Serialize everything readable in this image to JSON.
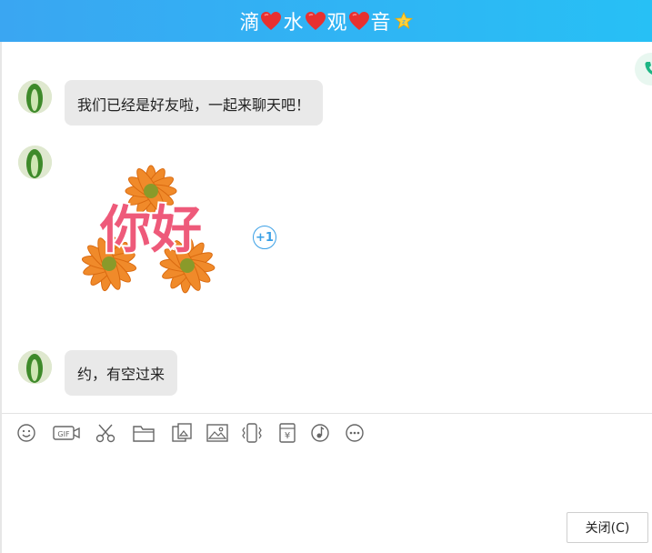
{
  "window": {
    "title_parts": [
      "滴",
      "水",
      "观",
      "音"
    ]
  },
  "messages": [
    {
      "type": "text",
      "text": "我们已经是好友啦，一起来聊天吧！"
    },
    {
      "type": "sticker",
      "sticker_text": "你好",
      "reaction": "+1"
    },
    {
      "type": "text",
      "text": "约，有空过来"
    }
  ],
  "toolbar": {
    "icons": [
      "emoji-icon",
      "gif-icon",
      "scissors-icon",
      "folder-icon",
      "image-edit-icon",
      "image-icon",
      "shake-icon",
      "red-packet-icon",
      "music-icon",
      "more-icon"
    ],
    "gif_label": "GIF",
    "yen_label": "¥"
  },
  "footer": {
    "close_label": "关闭(C)"
  },
  "colors": {
    "titlebar_start": "#3aa6f2",
    "titlebar_end": "#27c0f5",
    "bubble": "#e9e9e9",
    "reaction": "#3aa0e6"
  }
}
